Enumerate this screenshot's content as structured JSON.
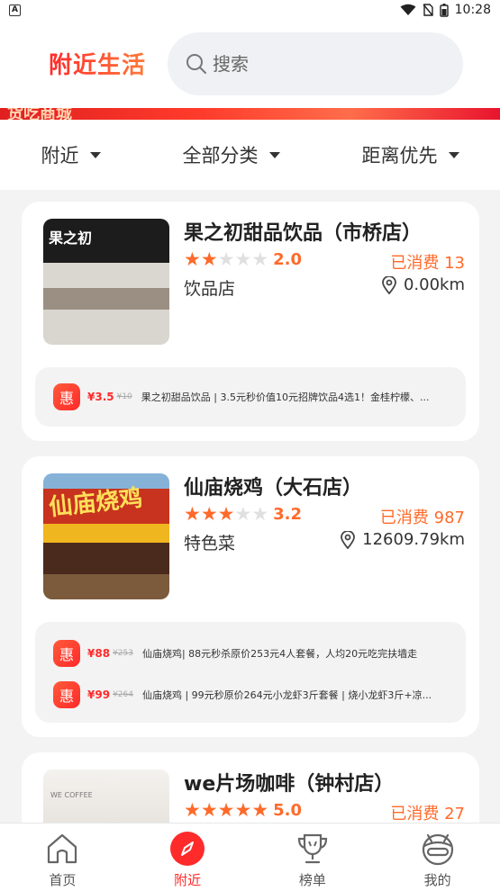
{
  "status": {
    "time": "10:28"
  },
  "header": {
    "logo": "附近生活",
    "search_placeholder": "搜索"
  },
  "banner": {
    "text": "货吃商城"
  },
  "filters": [
    {
      "label": "附近"
    },
    {
      "label": "全部分类"
    },
    {
      "label": "距离优先"
    }
  ],
  "shops": [
    {
      "name": "果之初甜品饮品（市桥店）",
      "rating": 2.0,
      "rating_text": "2.0",
      "sold": "已消费  13",
      "category": "饮品店",
      "distance": "0.00km",
      "thumb_sign": "果之初",
      "deals": [
        {
          "icon": "惠",
          "price": "¥3.5",
          "original": "¥10",
          "text": "果之初甜品饮品 | 3.5元秒价值10元招牌饮品4选1！金桂柠檬、..."
        }
      ]
    },
    {
      "name": "仙庙烧鸡（大石店）",
      "rating": 3.2,
      "rating_text": "3.2",
      "sold": "已消费  987",
      "category": "特色菜",
      "distance": "12609.79km",
      "thumb_sign": "仙庙烧鸡",
      "deals": [
        {
          "icon": "惠",
          "price": "¥88",
          "original": "¥253",
          "text": "仙庙烧鸡| 88元秒杀原价253元4人套餐，人均20元吃完扶墙走"
        },
        {
          "icon": "惠",
          "price": "¥99",
          "original": "¥264",
          "text": "仙庙烧鸡 | 99元秒原价264元小龙虾3斤套餐 | 烧小龙虾3斤+凉..."
        }
      ]
    },
    {
      "name": "we片场咖啡（钟村店）",
      "rating": 5.0,
      "rating_text": "5.0",
      "sold": "已消费  27",
      "thumb_sign": "WE COFFEE"
    }
  ],
  "tabbar": [
    {
      "label": "首页",
      "icon": "home-icon"
    },
    {
      "label": "附近",
      "icon": "compass-icon"
    },
    {
      "label": "榜单",
      "icon": "trophy-icon"
    },
    {
      "label": "我的",
      "icon": "profile-icon"
    }
  ],
  "colors": {
    "accent": "#ff2a2a",
    "star": "#ff6a2a"
  }
}
